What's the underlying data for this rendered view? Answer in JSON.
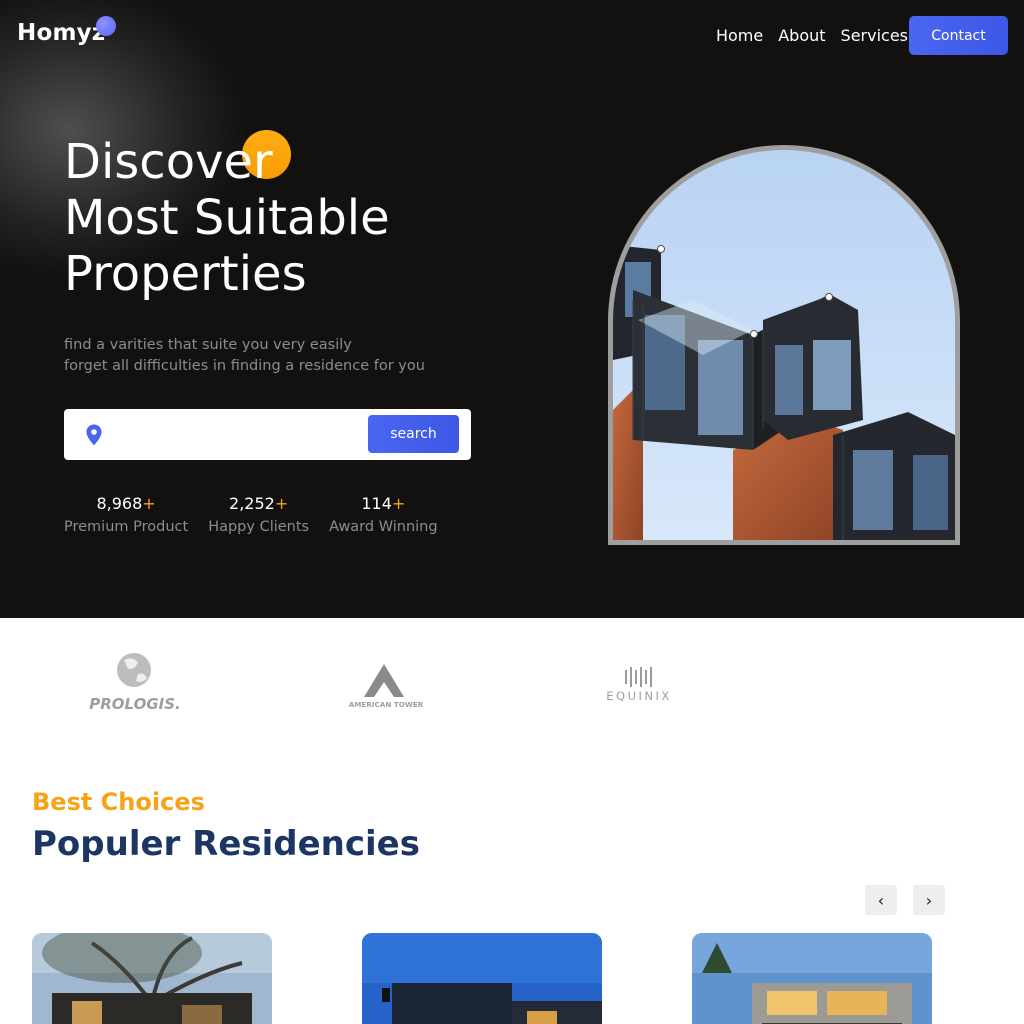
{
  "brand": {
    "name": "Homyz"
  },
  "nav": {
    "items": [
      "Home",
      "About",
      "Services"
    ],
    "contact_label": "Contact"
  },
  "hero": {
    "title_lines": [
      "Discover",
      "Most Suitable",
      "Properties"
    ],
    "description_lines": [
      "find a varities that suite you very easily",
      "forget all difficulties in finding a residence for you"
    ],
    "search": {
      "placeholder": "",
      "button_label": "search"
    },
    "stats": [
      {
        "value": "8,968",
        "suffix": "+",
        "label": "Premium Product"
      },
      {
        "value": "2,252",
        "suffix": "+",
        "label": "Happy Clients"
      },
      {
        "value": "114",
        "suffix": "+",
        "label": "Award Winning"
      }
    ],
    "colors": {
      "background": "#131110",
      "accent_orange": "#f8a21a",
      "accent_blue": "#4a66f1"
    }
  },
  "partners": [
    "PROLOGIS.",
    "AMERICAN TOWER",
    "EQUINIX"
  ],
  "residencies": {
    "eyebrow": "Best Choices",
    "title": "Populer Residencies",
    "prev_icon": "chevron-left-icon",
    "next_icon": "chevron-right-icon",
    "prev_glyph": "‹",
    "next_glyph": "›"
  }
}
